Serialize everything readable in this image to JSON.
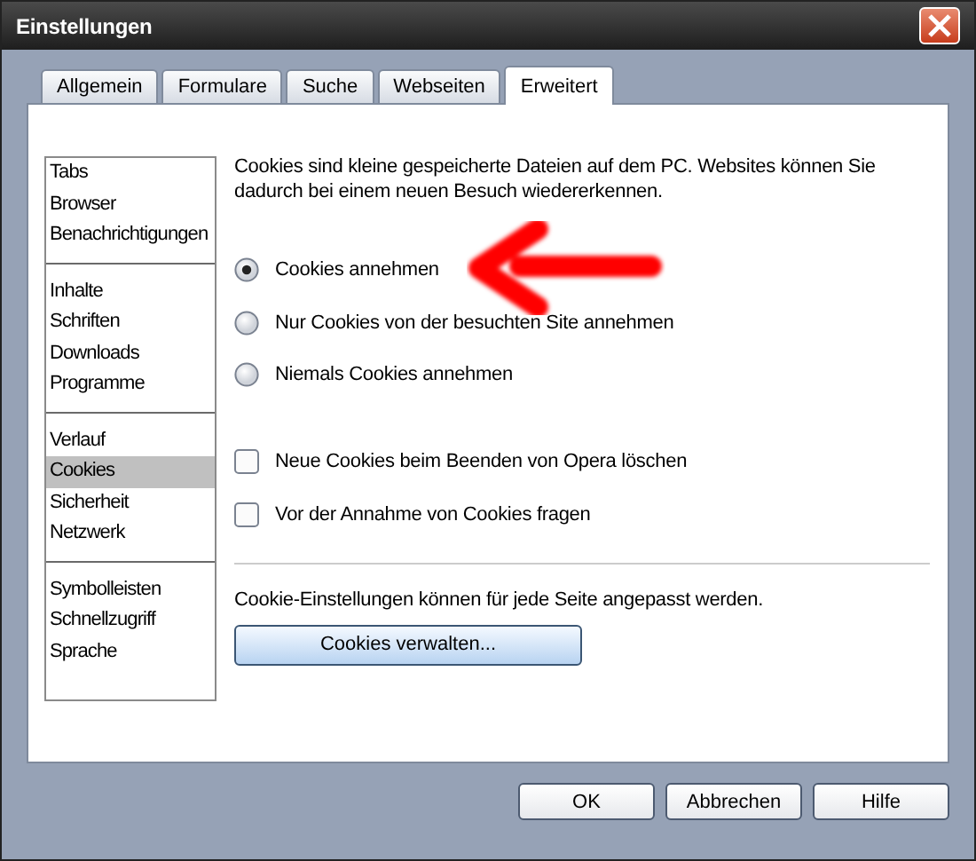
{
  "window": {
    "title": "Einstellungen"
  },
  "tabs": [
    {
      "label": "Allgemein",
      "selected": false
    },
    {
      "label": "Formulare",
      "selected": false
    },
    {
      "label": "Suche",
      "selected": false
    },
    {
      "label": "Webseiten",
      "selected": false
    },
    {
      "label": "Erweitert",
      "selected": true
    }
  ],
  "sidebar": {
    "groups": [
      {
        "items": [
          {
            "label": "Tabs",
            "selected": false
          },
          {
            "label": "Browser",
            "selected": false
          },
          {
            "label": "Benachrichtigungen",
            "selected": false
          }
        ]
      },
      {
        "items": [
          {
            "label": "Inhalte",
            "selected": false
          },
          {
            "label": "Schriften",
            "selected": false
          },
          {
            "label": "Downloads",
            "selected": false
          },
          {
            "label": "Programme",
            "selected": false
          }
        ]
      },
      {
        "items": [
          {
            "label": "Verlauf",
            "selected": false
          },
          {
            "label": "Cookies",
            "selected": true
          },
          {
            "label": "Sicherheit",
            "selected": false
          },
          {
            "label": "Netzwerk",
            "selected": false
          }
        ]
      },
      {
        "items": [
          {
            "label": "Symbolleisten",
            "selected": false
          },
          {
            "label": "Schnellzugriff",
            "selected": false
          },
          {
            "label": "Sprache",
            "selected": false
          }
        ]
      }
    ]
  },
  "description": "Cookies sind kleine gespeicherte Dateien auf dem PC. Websites können Sie dadurch bei einem neuen Besuch wiedererkennen.",
  "radios": [
    {
      "label": "Cookies annehmen",
      "selected": true
    },
    {
      "label": "Nur Cookies von der besuchten Site annehmen",
      "selected": false
    },
    {
      "label": "Niemals Cookies annehmen",
      "selected": false
    }
  ],
  "checkboxes": [
    {
      "label": "Neue Cookies beim Beenden von Opera löschen",
      "checked": false
    },
    {
      "label": "Vor der Annahme von Cookies fragen",
      "checked": false
    }
  ],
  "site_note": "Cookie-Einstellungen können für jede Seite angepasst werden.",
  "manage_button": "Cookies verwalten...",
  "buttons": [
    "OK",
    "Abbrechen",
    "Hilfe"
  ]
}
